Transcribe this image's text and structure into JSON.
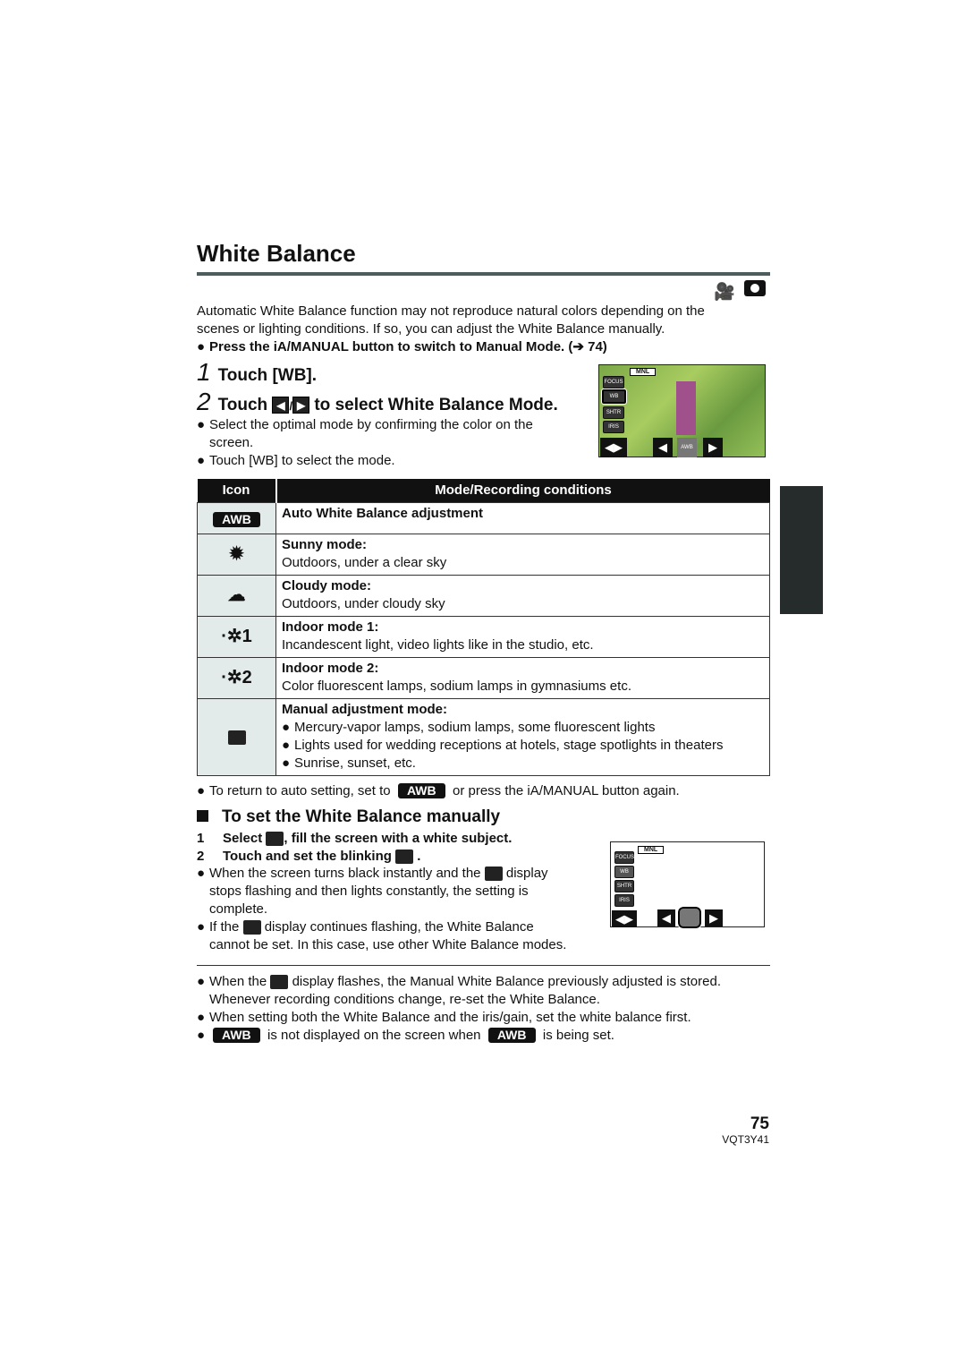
{
  "title": "White Balance",
  "mode_icons": [
    "video-camera-icon",
    "camera-icon"
  ],
  "intro": [
    "Automatic White Balance function may not reproduce natural colors depending on the",
    "scenes or lighting conditions. If so, you can adjust the White Balance manually."
  ],
  "press_note": "Press the iA/MANUAL button to switch to Manual Mode. (➔ 74)",
  "steps": [
    {
      "num": "1",
      "text": "Touch [WB]."
    },
    {
      "num": "2",
      "pre": "Touch",
      "slash": "/",
      "post": "to select White Balance Mode."
    }
  ],
  "step_notes": [
    "Select the optimal mode by confirming the color on the",
    "screen.",
    "Touch [WB] to select the mode."
  ],
  "screen": {
    "mnl": "MNL",
    "buttons": [
      "FOCUS",
      "WB",
      "SHTR",
      "IRIS"
    ],
    "awb": "AWB"
  },
  "table": {
    "headers": [
      "Icon",
      "Mode/Recording conditions"
    ],
    "rows": [
      {
        "icon": "AWB",
        "title": "Auto White Balance adjustment",
        "desc": []
      },
      {
        "icon": "sun-icon",
        "title": "Sunny mode:",
        "desc": [
          "Outdoors, under a clear sky"
        ]
      },
      {
        "icon": "cloud-icon",
        "title": "Cloudy mode:",
        "desc": [
          "Outdoors, under cloudy sky"
        ]
      },
      {
        "icon": "indoor-1-icon",
        "title": "Indoor mode 1:",
        "desc": [
          "Incandescent light, video lights like in the studio, etc."
        ]
      },
      {
        "icon": "indoor-2-icon",
        "title": "Indoor mode 2:",
        "desc": [
          "Color fluorescent lamps, sodium lamps in gymnasiums etc."
        ]
      },
      {
        "icon": "manual-wb-icon",
        "title": "Manual adjustment mode:",
        "desc": [
          "Mercury-vapor lamps, sodium lamps, some fluorescent lights",
          "Lights used for wedding receptions at hotels, stage spotlights in theaters",
          "Sunrise, sunset, etc."
        ]
      }
    ]
  },
  "return_note": {
    "pre": "To return to auto setting, set to",
    "awb": "AWB",
    "post": "or press the iA/MANUAL button again."
  },
  "manual": {
    "heading": "To set the White Balance manually",
    "step1": {
      "num": "1",
      "pre": "Select",
      "post": ", fill the screen with a white subject."
    },
    "step2": {
      "num": "2",
      "pre": "Touch and set the blinking",
      "post": "."
    },
    "notes": [
      {
        "pre": "When the screen turns black instantly and the",
        "post": "display"
      },
      "stops flashing and then lights constantly, the setting is",
      "complete.",
      {
        "pre": "If the",
        "post": "display continues flashing, the White Balance"
      },
      "cannot be set. In this case, use other White Balance modes."
    ]
  },
  "footer_notes": [
    {
      "pre": "When the",
      "post": "display flashes, the Manual White Balance previously adjusted is stored."
    },
    "Whenever recording conditions change, re-set the White Balance.",
    "When setting both the White Balance and the iris/gain, set the white balance first.",
    {
      "awb": "AWB",
      "mid": "is not displayed on the screen when",
      "post": "is being set."
    }
  ],
  "page_number": "75",
  "doc_code": "VQT3Y41"
}
